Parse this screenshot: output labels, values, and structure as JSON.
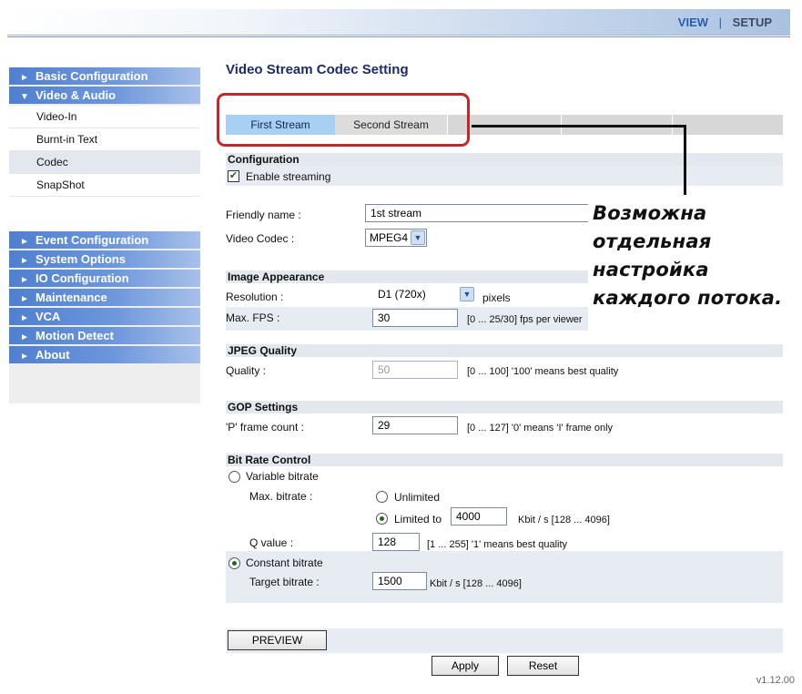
{
  "top_nav": {
    "view": "VIEW",
    "separator": "|",
    "setup": "SETUP"
  },
  "sidebar": {
    "basic": "Basic Configuration",
    "video_audio": "Video & Audio",
    "sub_items": [
      "Video-In",
      "Burnt-in Text",
      "Codec",
      "SnapShot"
    ],
    "event": "Event Configuration",
    "system": "System Options",
    "io": "IO Configuration",
    "maintenance": "Maintenance",
    "vca": "VCA",
    "motion": "Motion Detect",
    "about": "About"
  },
  "page": {
    "title": "Video Stream Codec Setting"
  },
  "tabs": {
    "first": "First Stream",
    "second": "Second Stream"
  },
  "configuration": {
    "header": "Configuration",
    "enable_label": "Enable streaming",
    "enable_checked": true,
    "friendly_label": "Friendly name :",
    "friendly_value": "1st stream",
    "codec_label": "Video Codec :",
    "codec_value": "MPEG4"
  },
  "image": {
    "header": "Image Appearance",
    "res_label": "Resolution :",
    "res_value": "D1 (720x)",
    "res_unit": "pixels",
    "fps_label": "Max. FPS :",
    "fps_value": "30",
    "fps_hint": "[0 ... 25/30] fps per viewer"
  },
  "jpeg": {
    "header": "JPEG Quality",
    "quality_label": "Quality :",
    "quality_value": "50",
    "quality_hint": "[0 ... 100] '100' means best quality"
  },
  "gop": {
    "header": "GOP Settings",
    "p_label": "'P' frame count :",
    "p_value": "29",
    "p_hint": "[0 ... 127] '0' means 'I' frame only"
  },
  "bitrate": {
    "header": "Bit Rate Control",
    "vbr_label": "Variable bitrate",
    "max_label": "Max. bitrate :",
    "unlimited": "Unlimited",
    "limited": "Limited to",
    "limited_value": "4000",
    "limited_hint": "Kbit / s [128 ... 4096]",
    "q_label": "Q value :",
    "q_value": "128",
    "q_hint": "[1 ... 255] '1' means best quality",
    "cbr_label": "Constant bitrate",
    "target_label": "Target bitrate :",
    "target_value": "1500",
    "target_hint": "Kbit / s [128 ... 4096]"
  },
  "buttons": {
    "preview": "PREVIEW",
    "apply": "Apply",
    "reset": "Reset"
  },
  "version": "v1.12.00",
  "annotation": {
    "lines": [
      "Возможна",
      "отдельная",
      "настройка",
      "каждого потока."
    ],
    "color": "#c0282b"
  }
}
